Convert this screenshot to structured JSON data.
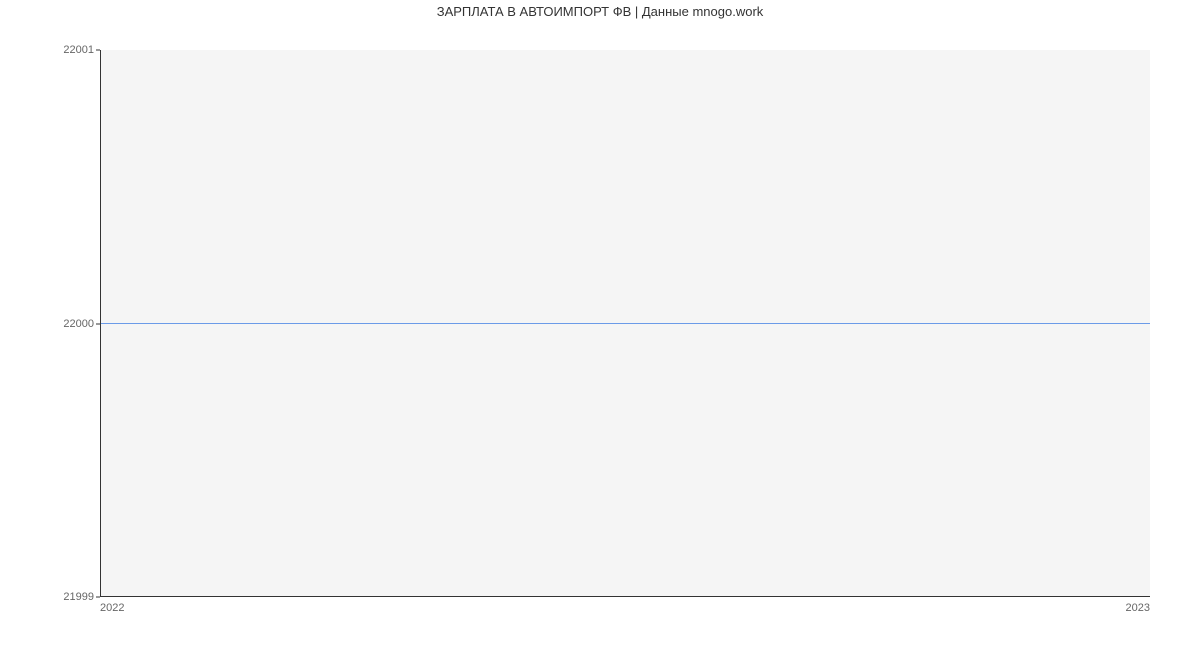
{
  "chart_data": {
    "type": "line",
    "title": "ЗАРПЛАТА В АВТОИМПОРТ ФВ | Данные mnogo.work",
    "x": [
      2022,
      2023
    ],
    "values": [
      22000,
      22000
    ],
    "xlabel": "",
    "ylabel": "",
    "xlim": [
      2022,
      2023
    ],
    "ylim": [
      21999,
      22001
    ],
    "y_ticks": [
      21999,
      22000,
      22001
    ],
    "x_ticks": [
      2022,
      2023
    ],
    "line_color": "#6b9be8"
  }
}
